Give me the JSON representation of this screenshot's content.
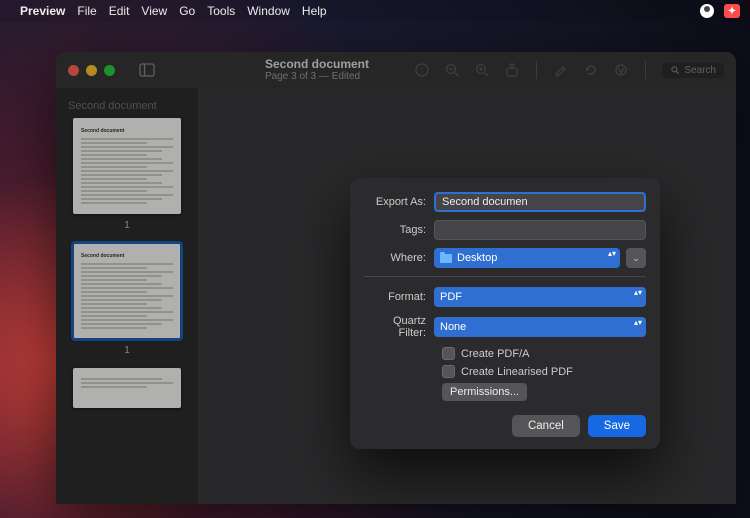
{
  "menubar": {
    "app": "Preview",
    "items": [
      "File",
      "Edit",
      "View",
      "Go",
      "Tools",
      "Window",
      "Help"
    ]
  },
  "window": {
    "title": "Second document",
    "subtitle": "Page 3 of 3 — Edited",
    "search_placeholder": "Search"
  },
  "sidebar": {
    "doc_title": "Second document",
    "thumbs": [
      {
        "num": "1",
        "selected": false
      },
      {
        "num": "1",
        "selected": true
      },
      {
        "num": "",
        "selected": false
      }
    ]
  },
  "dialog": {
    "export_as_label": "Export As:",
    "export_as_value": "Second documen",
    "tags_label": "Tags:",
    "tags_value": "",
    "where_label": "Where:",
    "where_value": "Desktop",
    "format_label": "Format:",
    "format_value": "PDF",
    "quartz_label": "Quartz Filter:",
    "quartz_value": "None",
    "create_pdfa": "Create PDF/A",
    "create_linearised": "Create Linearised PDF",
    "permissions": "Permissions...",
    "cancel": "Cancel",
    "save": "Save"
  }
}
